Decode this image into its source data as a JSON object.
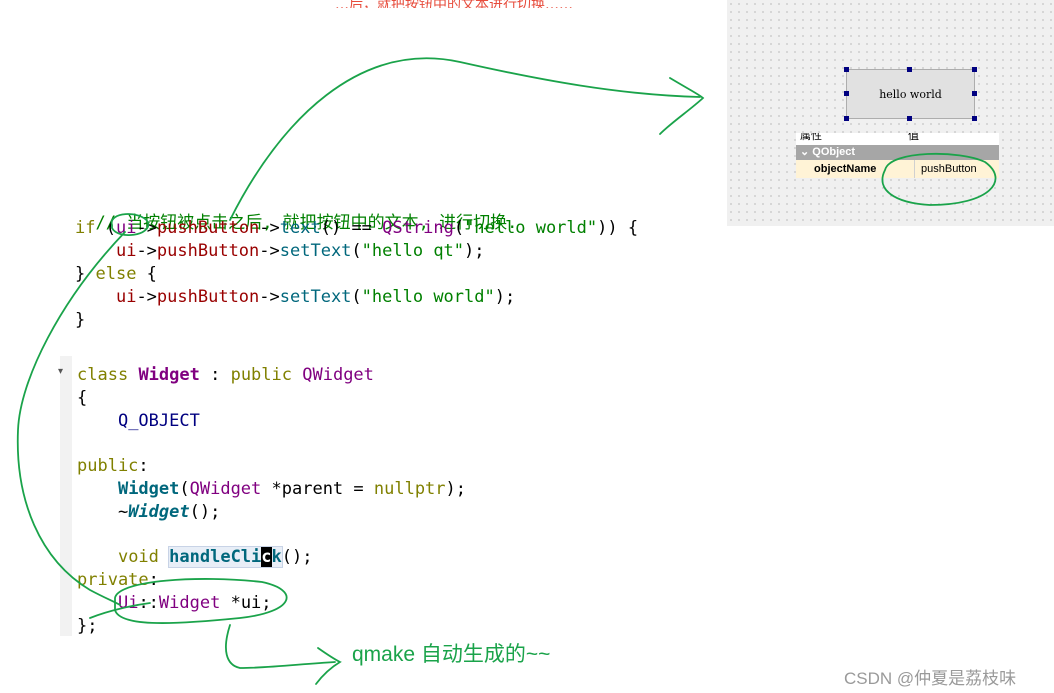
{
  "header_fragment": "…后，就把按钮中的文本进行切换……",
  "code_top": {
    "comment": "// 当按钮被点击之后, 就把按钮中的文本, 进行切换.",
    "if_kw": "if",
    "if_open": " (",
    "ui": "ui",
    "arrow1": "->",
    "pushButton": "pushButton",
    "arrow2": "->",
    "text_fn": "text",
    "eq": "() == ",
    "qstring": "QString",
    "p1": "(",
    "hello_world": "\"hello world\"",
    "close_brace": ")) {",
    "indent": "    ",
    "settext": "setText",
    "p2": "(",
    "hello_qt": "\"hello qt\"",
    "end_call": ");",
    "else_open": "} ",
    "else_kw": "else",
    "else_brace": " {",
    "close": "}"
  },
  "code_class": {
    "class_kw": "class",
    "widget": "Widget",
    "colon": " : ",
    "public_kw": "public",
    "qwidget": "QWidget",
    "open_brace": "{",
    "q_object": "Q_OBJECT",
    "public_label": "public",
    "colon_end": ":",
    "ctor_params": "(",
    "ptr_parent": " *parent = ",
    "nullptr": "nullptr",
    "ctor_end": ");",
    "tilde": "~",
    "dtor_end": "();",
    "void_kw": "void",
    "handle_a": "handleCli",
    "handle_c": "c",
    "handle_k": "k",
    "handle_end": "();",
    "private_label": "private",
    "ui_ns": "Ui",
    "scope": "::",
    "ui_ptr": " *ui;",
    "close_class": "};"
  },
  "designer": {
    "button_text": "hello world",
    "props_header_left": "属性",
    "props_header_right": "值",
    "section": "QObject",
    "prop_key": "objectName",
    "prop_value": "pushButton"
  },
  "annotation": "qmake 自动生成的~~",
  "watermark": "CSDN @仲夏是荔枝味",
  "colors": {
    "annotation_green": "#1aa34a",
    "keyword": "#808000",
    "class": "#800080",
    "function": "#00677c",
    "string": "#008000"
  }
}
